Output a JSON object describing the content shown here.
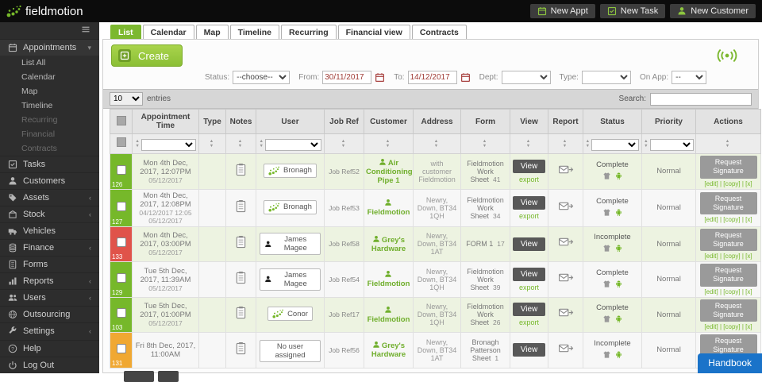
{
  "topbar": {
    "logo": "fieldmotion",
    "buttons": [
      {
        "label": "New Appt",
        "icon": "calendar"
      },
      {
        "label": "New Task",
        "icon": "tasks"
      },
      {
        "label": "New Customer",
        "icon": "person"
      }
    ]
  },
  "sidebar": {
    "primary": {
      "label": "Appointments",
      "icon": "calendar",
      "expanded": true
    },
    "sub_items": [
      {
        "label": "List All",
        "enabled": true
      },
      {
        "label": "Calendar",
        "enabled": true
      },
      {
        "label": "Map",
        "enabled": true
      },
      {
        "label": "Timeline",
        "enabled": true
      },
      {
        "label": "Recurring",
        "enabled": false
      },
      {
        "label": "Financial",
        "enabled": false
      },
      {
        "label": "Contracts",
        "enabled": false
      }
    ],
    "items": [
      {
        "label": "Tasks",
        "icon": "tasks",
        "collapsible": false
      },
      {
        "label": "Customers",
        "icon": "person",
        "collapsible": false
      },
      {
        "label": "Assets",
        "icon": "tag",
        "collapsible": true
      },
      {
        "label": "Stock",
        "icon": "box",
        "collapsible": true
      },
      {
        "label": "Vehicles",
        "icon": "truck",
        "collapsible": false
      },
      {
        "label": "Finance",
        "icon": "coins",
        "collapsible": true
      },
      {
        "label": "Forms",
        "icon": "document",
        "collapsible": false
      },
      {
        "label": "Reports",
        "icon": "bar-chart",
        "collapsible": true
      },
      {
        "label": "Users",
        "icon": "users",
        "collapsible": true
      },
      {
        "label": "Outsourcing",
        "icon": "globe",
        "collapsible": false
      },
      {
        "label": "Settings",
        "icon": "wrench",
        "collapsible": true
      }
    ],
    "footer_items": [
      {
        "label": "Help",
        "icon": "question"
      },
      {
        "label": "Log Out",
        "icon": "power"
      }
    ]
  },
  "tabs": [
    {
      "label": "List",
      "active": true
    },
    {
      "label": "Calendar",
      "active": false
    },
    {
      "label": "Map",
      "active": false
    },
    {
      "label": "Timeline",
      "active": false
    },
    {
      "label": "Recurring",
      "active": false
    },
    {
      "label": "Financial view",
      "active": false
    },
    {
      "label": "Contracts",
      "active": false
    }
  ],
  "toolbar": {
    "create_label": "Create"
  },
  "filters": {
    "status_label": "Status:",
    "status_value": "--choose--",
    "from_label": "From:",
    "from_value": "30/11/2017",
    "to_label": "To:",
    "to_value": "14/12/2017",
    "dept_label": "Dept:",
    "dept_value": "",
    "type_label": "Type:",
    "type_value": "",
    "onapp_label": "On App:",
    "onapp_value": "--"
  },
  "list_controls": {
    "entries_value": "10",
    "entries_label": "entries",
    "search_label": "Search:",
    "search_value": ""
  },
  "table": {
    "columns": [
      "",
      "Appointment Time",
      "Type",
      "Notes",
      "User",
      "Job Ref",
      "Customer",
      "Address",
      "Form",
      "View",
      "Report",
      "Status",
      "Priority",
      "Actions"
    ],
    "view_label": "View",
    "export_label": "export",
    "action_label": "Request Signature",
    "row_links": "[edit] | [copy] | [x]",
    "rows": [
      {
        "id": "126",
        "marker": "#76b82a",
        "time": "Mon 4th Dec, 2017, 12:07PM",
        "time_sub1": "05/12/2017",
        "time_sub2": "",
        "type": "",
        "note": true,
        "user_name": "Bronagh",
        "user_icon": "fm-logo",
        "job_ref": "Job Ref52",
        "customer": "Air Conditioning Pipe 1",
        "address": "with customer Fieldmotion",
        "form": "Fieldmotion Work Sheet",
        "form_num": "41",
        "export": true,
        "status": "Complete",
        "priority": "Normal"
      },
      {
        "id": "127",
        "marker": "#76b82a",
        "time": "Mon 4th Dec, 2017, 12:08PM",
        "time_sub1": "04/12/2017 12:05",
        "time_sub2": "05/12/2017",
        "type": "",
        "note": true,
        "user_name": "Bronagh",
        "user_icon": "fm-logo",
        "job_ref": "Job Ref53",
        "customer": "Fieldmotion",
        "address": "Newry, Down, BT34 1QH",
        "form": "Fieldmotion Work Sheet",
        "form_num": "34",
        "export": true,
        "status": "Complete",
        "priority": "Normal"
      },
      {
        "id": "133",
        "marker": "#e0534a",
        "time": "Mon 4th Dec, 2017, 03:00PM",
        "time_sub1": "05/12/2017",
        "time_sub2": "",
        "type": "",
        "note": true,
        "user_name": "James Magee",
        "user_icon": "person",
        "job_ref": "Job Ref58",
        "customer": "Grey's Hardware",
        "address": "Newry, Down, BT34 1AT",
        "form": "FORM 1",
        "form_num": "17",
        "export": false,
        "status": "Incomplete",
        "priority": "Normal"
      },
      {
        "id": "129",
        "marker": "#76b82a",
        "time": "Tue 5th Dec, 2017, 11:39AM",
        "time_sub1": "05/12/2017",
        "time_sub2": "",
        "type": "",
        "note": true,
        "user_name": "James Magee",
        "user_icon": "person",
        "job_ref": "Job Ref54",
        "customer": "Fieldmotion",
        "address": "Newry, Down, BT34 1QH",
        "form": "Fieldmotion Work Sheet",
        "form_num": "39",
        "export": true,
        "status": "Complete",
        "priority": "Normal"
      },
      {
        "id": "103",
        "marker": "#76b82a",
        "time": "Tue 5th Dec, 2017, 01:00PM",
        "time_sub1": "05/12/2017",
        "time_sub2": "",
        "type": "",
        "note": true,
        "user_name": "Conor",
        "user_icon": "fm-logo",
        "job_ref": "Job Ref17",
        "customer": "Fieldmotion",
        "address": "Newry, Down, BT34 1QH",
        "form": "Fieldmotion Work Sheet",
        "form_num": "26",
        "export": true,
        "status": "Complete",
        "priority": "Normal"
      },
      {
        "id": "131",
        "marker": "#f0a832",
        "time": "Fri 8th Dec, 2017, 11:00AM",
        "time_sub1": "",
        "time_sub2": "",
        "type": "",
        "note": true,
        "user_name": "No user assigned",
        "user_icon": "none",
        "job_ref": "Job Ref56",
        "customer": "Grey's Hardware",
        "address": "Newry, Down, BT34 1AT",
        "form": "Bronagh Patterson Sheet",
        "form_num": "1",
        "export": false,
        "status": "Incomplete",
        "priority": "Normal"
      }
    ]
  },
  "handbook_label": "Handbook",
  "colors": {
    "accent_green": "#76b82a",
    "status_red": "#e0534a",
    "status_orange": "#f0a832",
    "handbook_blue": "#1a73c9"
  }
}
